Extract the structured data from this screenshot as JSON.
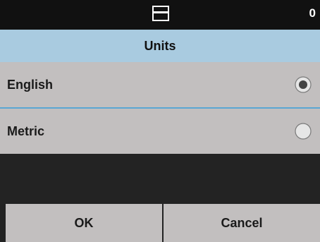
{
  "status_bar": {
    "icon": "scanner-icon",
    "counter": "0"
  },
  "dialog": {
    "title": "Units",
    "options": [
      {
        "label": "English",
        "selected": true
      },
      {
        "label": "Metric",
        "selected": false
      }
    ]
  },
  "buttons": {
    "ok_label": "OK",
    "cancel_label": "Cancel"
  },
  "colors": {
    "title_bar": "#a9cbe0",
    "row_background": "#c2bfbf",
    "divider": "#5aa6d3",
    "screen_background": "#222222"
  }
}
